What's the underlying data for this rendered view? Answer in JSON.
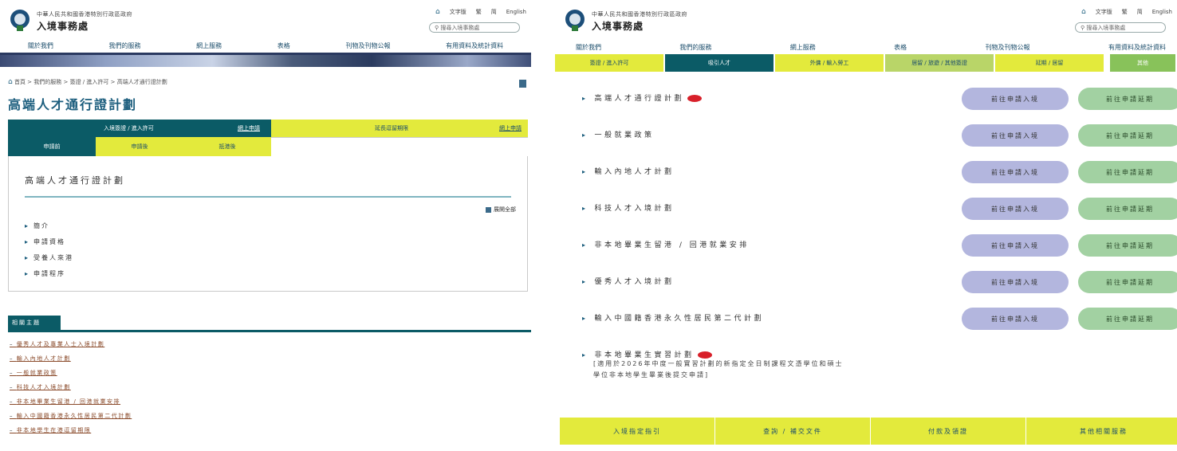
{
  "left": {
    "dept_subtitle": "中華人民共和國香港特別行政區政府",
    "dept_name": "入境事務處",
    "util_links": [
      "文字版",
      "繁",
      "简",
      "English"
    ],
    "search_placeholder": "搜尋入境事務處",
    "nav": [
      "關於我們",
      "我們的服務",
      "網上服務",
      "表格",
      "刊物及刊物公報",
      "有用資料及統計資料"
    ],
    "breadcrumb": "首頁 > 我們的服務 > 簽證 / 進入許可 > 高端人才通行證計劃",
    "page_title": "高端人才通行證計劃",
    "tabs_row1": [
      "入境簽證 / 進入許可",
      "網上申請",
      "延長逗留期限",
      "網上申請"
    ],
    "tabs_row2": [
      "申請前",
      "申請後",
      "抵港後"
    ],
    "box_title": "高端人才通行證計劃",
    "expand_label": "展開全部",
    "items": [
      "簡介",
      "申請資格",
      "受養人來港",
      "申請程序"
    ],
    "related_title": "相關主題",
    "related": [
      "優秀人才及專業人士入境計劃",
      "輸入內地人才計劃",
      "一般就業政策",
      "科技人才入境計劃",
      "非本地畢業生留港 / 回港就業安排",
      "輸入中國籍香港永久性居民第二代計劃",
      "非本地學生在港逗留期限"
    ]
  },
  "right": {
    "dept_subtitle": "中華人民共和國香港特別行政區政府",
    "dept_name": "入境事務處",
    "util_links": [
      "文字版",
      "繁",
      "简",
      "English"
    ],
    "search_placeholder": "搜尋入境事務處",
    "nav": [
      "關於我們",
      "我們的服務",
      "網上服務",
      "表格",
      "刊物及刊物公報",
      "有用資料及統計資料"
    ],
    "tabs": [
      "簽證 / 進入許可",
      "吸引人才",
      "外傭 / 輸入勞工",
      "居留 / 旅遊 / 其他簽證",
      "延期 / 居留",
      "",
      "其他"
    ],
    "programmes": [
      {
        "name": "高端人才通行證計劃",
        "new": true,
        "btn1": "前往申請入境",
        "btn2": "前往申請延期"
      },
      {
        "name": "一般就業政策",
        "new": false,
        "btn1": "前往申請入境",
        "btn2": "前往申請延期"
      },
      {
        "name": "輸入內地人才計劃",
        "new": false,
        "btn1": "前往申請入境",
        "btn2": "前往申請延期"
      },
      {
        "name": "科技人才入境計劃",
        "new": false,
        "btn1": "前往申請入境",
        "btn2": "前往申請延期"
      },
      {
        "name": "非本地畢業生留港 / 回港就業安排",
        "new": false,
        "btn1": "前往申請入境",
        "btn2": "前往申請延期"
      },
      {
        "name": "優秀人才入境計劃",
        "new": false,
        "btn1": "前往申請入境",
        "btn2": "前往申請延期"
      },
      {
        "name": "輸入中國籍香港永久性居民第二代計劃",
        "new": false,
        "btn1": "前往申請入境",
        "btn2": "前往申請延期"
      }
    ],
    "last_programme": "非本地畢業生實習計劃",
    "last_note_1": "[適用於2026年中度一般實習計劃的新指定全日制課程文憑學位和碩士",
    "last_note_2": "學位非本地學生畢業後提交申請]",
    "footer_tabs": [
      "入境指定指引",
      "查詢 / 補交文件",
      "付款及領證",
      "其他相關服務"
    ]
  }
}
